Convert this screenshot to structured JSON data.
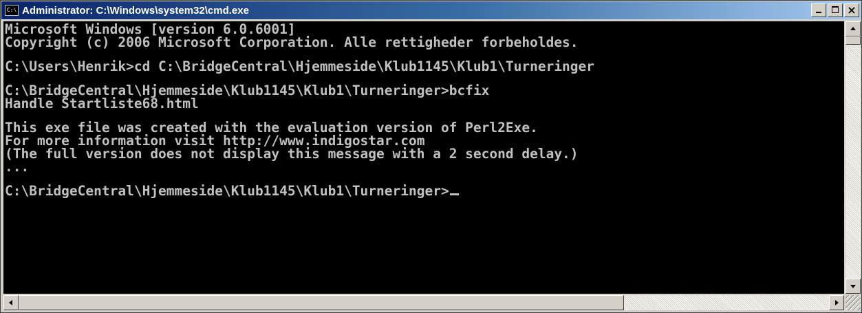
{
  "window": {
    "title": "Administrator: C:\\Windows\\system32\\cmd.exe",
    "icon_text": "C:\\",
    "buttons": {
      "minimize": "minimize-icon",
      "maximize": "maximize-icon",
      "close": "×"
    }
  },
  "console": {
    "lines": [
      "Microsoft Windows [version 6.0.6001]",
      "Copyright (c) 2006 Microsoft Corporation. Alle rettigheder forbeholdes.",
      "",
      "C:\\Users\\Henrik>cd C:\\BridgeCentral\\Hjemmeside\\Klub1145\\Klub1\\Turneringer",
      "",
      "C:\\BridgeCentral\\Hjemmeside\\Klub1145\\Klub1\\Turneringer>bcfix",
      "Handle Startliste68.html",
      "",
      "This exe file was created with the evaluation version of Perl2Exe.",
      "For more information visit http://www.indigostar.com",
      "(The full version does not display this message with a 2 second delay.)",
      "...",
      "",
      "C:\\BridgeCentral\\Hjemmeside\\Klub1145\\Klub1\\Turneringer>"
    ],
    "colors": {
      "background": "#000000",
      "text": "#c0c0c0"
    }
  },
  "scrollbars": {
    "vertical": {
      "up": "arrow-up-icon",
      "down": "arrow-down-icon"
    },
    "horizontal": {
      "left": "arrow-left-icon",
      "right": "arrow-right-icon"
    }
  }
}
